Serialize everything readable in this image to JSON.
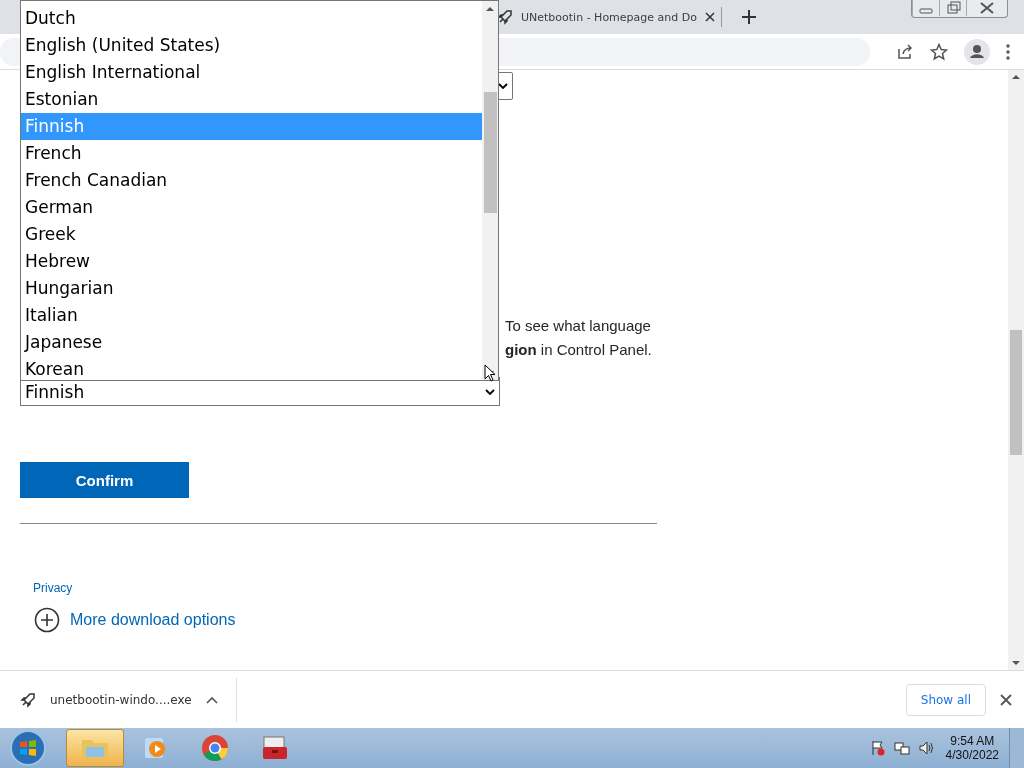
{
  "browser": {
    "tab": {
      "title": "UNetbootin - Homepage and Do"
    }
  },
  "page": {
    "paragraph_lines": [
      "To see what language",
      "**gion** in Control Panel."
    ],
    "language_select": {
      "value": "Finnish"
    },
    "confirm_button": "Confirm",
    "privacy_link": "Privacy",
    "more_options_link": "More download options"
  },
  "dropdown": {
    "options": [
      {
        "label": "Dutch",
        "selected": false
      },
      {
        "label": "English (United States)",
        "selected": false
      },
      {
        "label": "English International",
        "selected": false
      },
      {
        "label": "Estonian",
        "selected": false
      },
      {
        "label": "Finnish",
        "selected": true
      },
      {
        "label": "French",
        "selected": false
      },
      {
        "label": "French Canadian",
        "selected": false
      },
      {
        "label": "German",
        "selected": false
      },
      {
        "label": "Greek",
        "selected": false
      },
      {
        "label": "Hebrew",
        "selected": false
      },
      {
        "label": "Hungarian",
        "selected": false
      },
      {
        "label": "Italian",
        "selected": false
      },
      {
        "label": "Japanese",
        "selected": false
      },
      {
        "label": "Korean",
        "selected": false
      }
    ]
  },
  "download_bar": {
    "file": "unetbootin-windo....exe",
    "show_all": "Show all"
  },
  "taskbar": {
    "apps": [
      {
        "kind": "explorer",
        "active": true
      },
      {
        "kind": "media",
        "active": false
      },
      {
        "kind": "chrome",
        "active": false
      },
      {
        "kind": "toolbox",
        "active": false
      }
    ],
    "clock": {
      "time": "9:54 AM",
      "date": "4/30/2022"
    }
  }
}
